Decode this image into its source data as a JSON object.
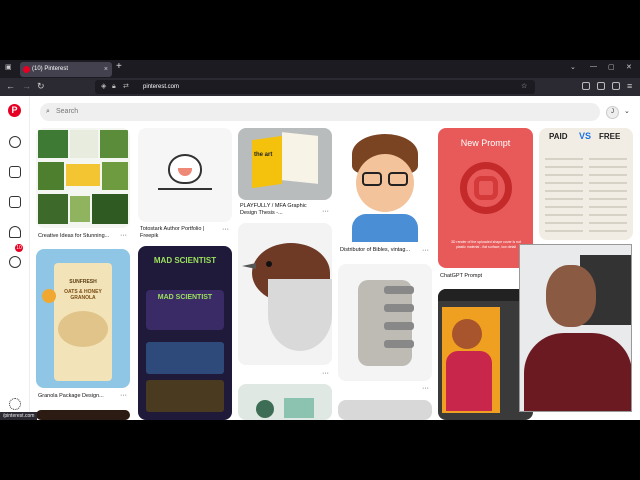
{
  "browser": {
    "tab_title": "(10) Pinterest",
    "url": "pinterest.com",
    "status_url": "/pinterest.com"
  },
  "pinterest": {
    "search_placeholder": "Search",
    "notification_count": "10",
    "avatar_initial": "J"
  },
  "pins": {
    "p1_caption": "Creative Ideas for Stunning...",
    "p2_caption": "Totostark Author Portfolio | Freepik",
    "p3_caption": "PLAYFULLY / MFA Graphic Design Thesis -...",
    "p3_book_text": "the art",
    "p4_caption": "Distributor of Bibles, vintag...",
    "p5_title": "New Prompt",
    "p5_sub": "3D render of the uploaded shape cover is not plastic material - flat surface, low detail",
    "p5_caption": "ChatGPT Prompt",
    "p6_paid": "PAID",
    "p6_vs": "VS",
    "p6_free": "FREE",
    "p7_brand": "SUNFRESH",
    "p7_product": "OATS & HONEY GRANOLA",
    "p7_caption": "Granola Package Design...",
    "p8_title": "MAD SCIENTIST",
    "p8_title2": "MAD SCIENTIST"
  }
}
